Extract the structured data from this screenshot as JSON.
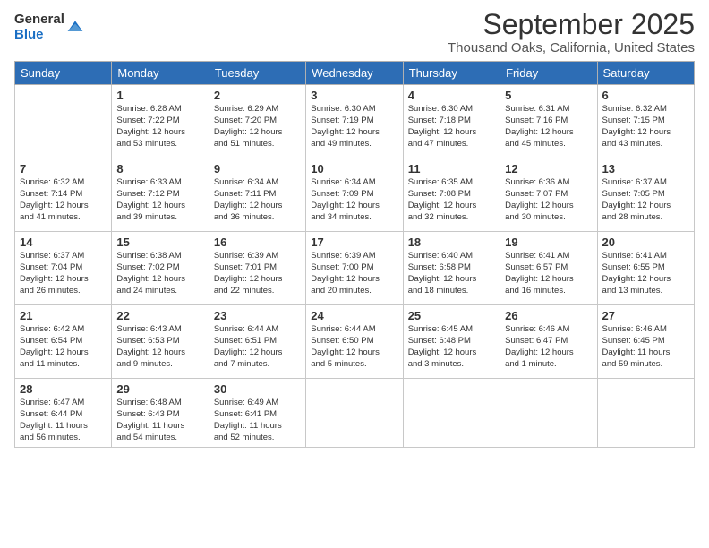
{
  "logo": {
    "general": "General",
    "blue": "Blue"
  },
  "header": {
    "month": "September 2025",
    "location": "Thousand Oaks, California, United States"
  },
  "weekdays": [
    "Sunday",
    "Monday",
    "Tuesday",
    "Wednesday",
    "Thursday",
    "Friday",
    "Saturday"
  ],
  "weeks": [
    [
      {
        "day": "",
        "info": ""
      },
      {
        "day": "1",
        "info": "Sunrise: 6:28 AM\nSunset: 7:22 PM\nDaylight: 12 hours\nand 53 minutes."
      },
      {
        "day": "2",
        "info": "Sunrise: 6:29 AM\nSunset: 7:20 PM\nDaylight: 12 hours\nand 51 minutes."
      },
      {
        "day": "3",
        "info": "Sunrise: 6:30 AM\nSunset: 7:19 PM\nDaylight: 12 hours\nand 49 minutes."
      },
      {
        "day": "4",
        "info": "Sunrise: 6:30 AM\nSunset: 7:18 PM\nDaylight: 12 hours\nand 47 minutes."
      },
      {
        "day": "5",
        "info": "Sunrise: 6:31 AM\nSunset: 7:16 PM\nDaylight: 12 hours\nand 45 minutes."
      },
      {
        "day": "6",
        "info": "Sunrise: 6:32 AM\nSunset: 7:15 PM\nDaylight: 12 hours\nand 43 minutes."
      }
    ],
    [
      {
        "day": "7",
        "info": "Sunrise: 6:32 AM\nSunset: 7:14 PM\nDaylight: 12 hours\nand 41 minutes."
      },
      {
        "day": "8",
        "info": "Sunrise: 6:33 AM\nSunset: 7:12 PM\nDaylight: 12 hours\nand 39 minutes."
      },
      {
        "day": "9",
        "info": "Sunrise: 6:34 AM\nSunset: 7:11 PM\nDaylight: 12 hours\nand 36 minutes."
      },
      {
        "day": "10",
        "info": "Sunrise: 6:34 AM\nSunset: 7:09 PM\nDaylight: 12 hours\nand 34 minutes."
      },
      {
        "day": "11",
        "info": "Sunrise: 6:35 AM\nSunset: 7:08 PM\nDaylight: 12 hours\nand 32 minutes."
      },
      {
        "day": "12",
        "info": "Sunrise: 6:36 AM\nSunset: 7:07 PM\nDaylight: 12 hours\nand 30 minutes."
      },
      {
        "day": "13",
        "info": "Sunrise: 6:37 AM\nSunset: 7:05 PM\nDaylight: 12 hours\nand 28 minutes."
      }
    ],
    [
      {
        "day": "14",
        "info": "Sunrise: 6:37 AM\nSunset: 7:04 PM\nDaylight: 12 hours\nand 26 minutes."
      },
      {
        "day": "15",
        "info": "Sunrise: 6:38 AM\nSunset: 7:02 PM\nDaylight: 12 hours\nand 24 minutes."
      },
      {
        "day": "16",
        "info": "Sunrise: 6:39 AM\nSunset: 7:01 PM\nDaylight: 12 hours\nand 22 minutes."
      },
      {
        "day": "17",
        "info": "Sunrise: 6:39 AM\nSunset: 7:00 PM\nDaylight: 12 hours\nand 20 minutes."
      },
      {
        "day": "18",
        "info": "Sunrise: 6:40 AM\nSunset: 6:58 PM\nDaylight: 12 hours\nand 18 minutes."
      },
      {
        "day": "19",
        "info": "Sunrise: 6:41 AM\nSunset: 6:57 PM\nDaylight: 12 hours\nand 16 minutes."
      },
      {
        "day": "20",
        "info": "Sunrise: 6:41 AM\nSunset: 6:55 PM\nDaylight: 12 hours\nand 13 minutes."
      }
    ],
    [
      {
        "day": "21",
        "info": "Sunrise: 6:42 AM\nSunset: 6:54 PM\nDaylight: 12 hours\nand 11 minutes."
      },
      {
        "day": "22",
        "info": "Sunrise: 6:43 AM\nSunset: 6:53 PM\nDaylight: 12 hours\nand 9 minutes."
      },
      {
        "day": "23",
        "info": "Sunrise: 6:44 AM\nSunset: 6:51 PM\nDaylight: 12 hours\nand 7 minutes."
      },
      {
        "day": "24",
        "info": "Sunrise: 6:44 AM\nSunset: 6:50 PM\nDaylight: 12 hours\nand 5 minutes."
      },
      {
        "day": "25",
        "info": "Sunrise: 6:45 AM\nSunset: 6:48 PM\nDaylight: 12 hours\nand 3 minutes."
      },
      {
        "day": "26",
        "info": "Sunrise: 6:46 AM\nSunset: 6:47 PM\nDaylight: 12 hours\nand 1 minute."
      },
      {
        "day": "27",
        "info": "Sunrise: 6:46 AM\nSunset: 6:45 PM\nDaylight: 11 hours\nand 59 minutes."
      }
    ],
    [
      {
        "day": "28",
        "info": "Sunrise: 6:47 AM\nSunset: 6:44 PM\nDaylight: 11 hours\nand 56 minutes."
      },
      {
        "day": "29",
        "info": "Sunrise: 6:48 AM\nSunset: 6:43 PM\nDaylight: 11 hours\nand 54 minutes."
      },
      {
        "day": "30",
        "info": "Sunrise: 6:49 AM\nSunset: 6:41 PM\nDaylight: 11 hours\nand 52 minutes."
      },
      {
        "day": "",
        "info": ""
      },
      {
        "day": "",
        "info": ""
      },
      {
        "day": "",
        "info": ""
      },
      {
        "day": "",
        "info": ""
      }
    ]
  ]
}
